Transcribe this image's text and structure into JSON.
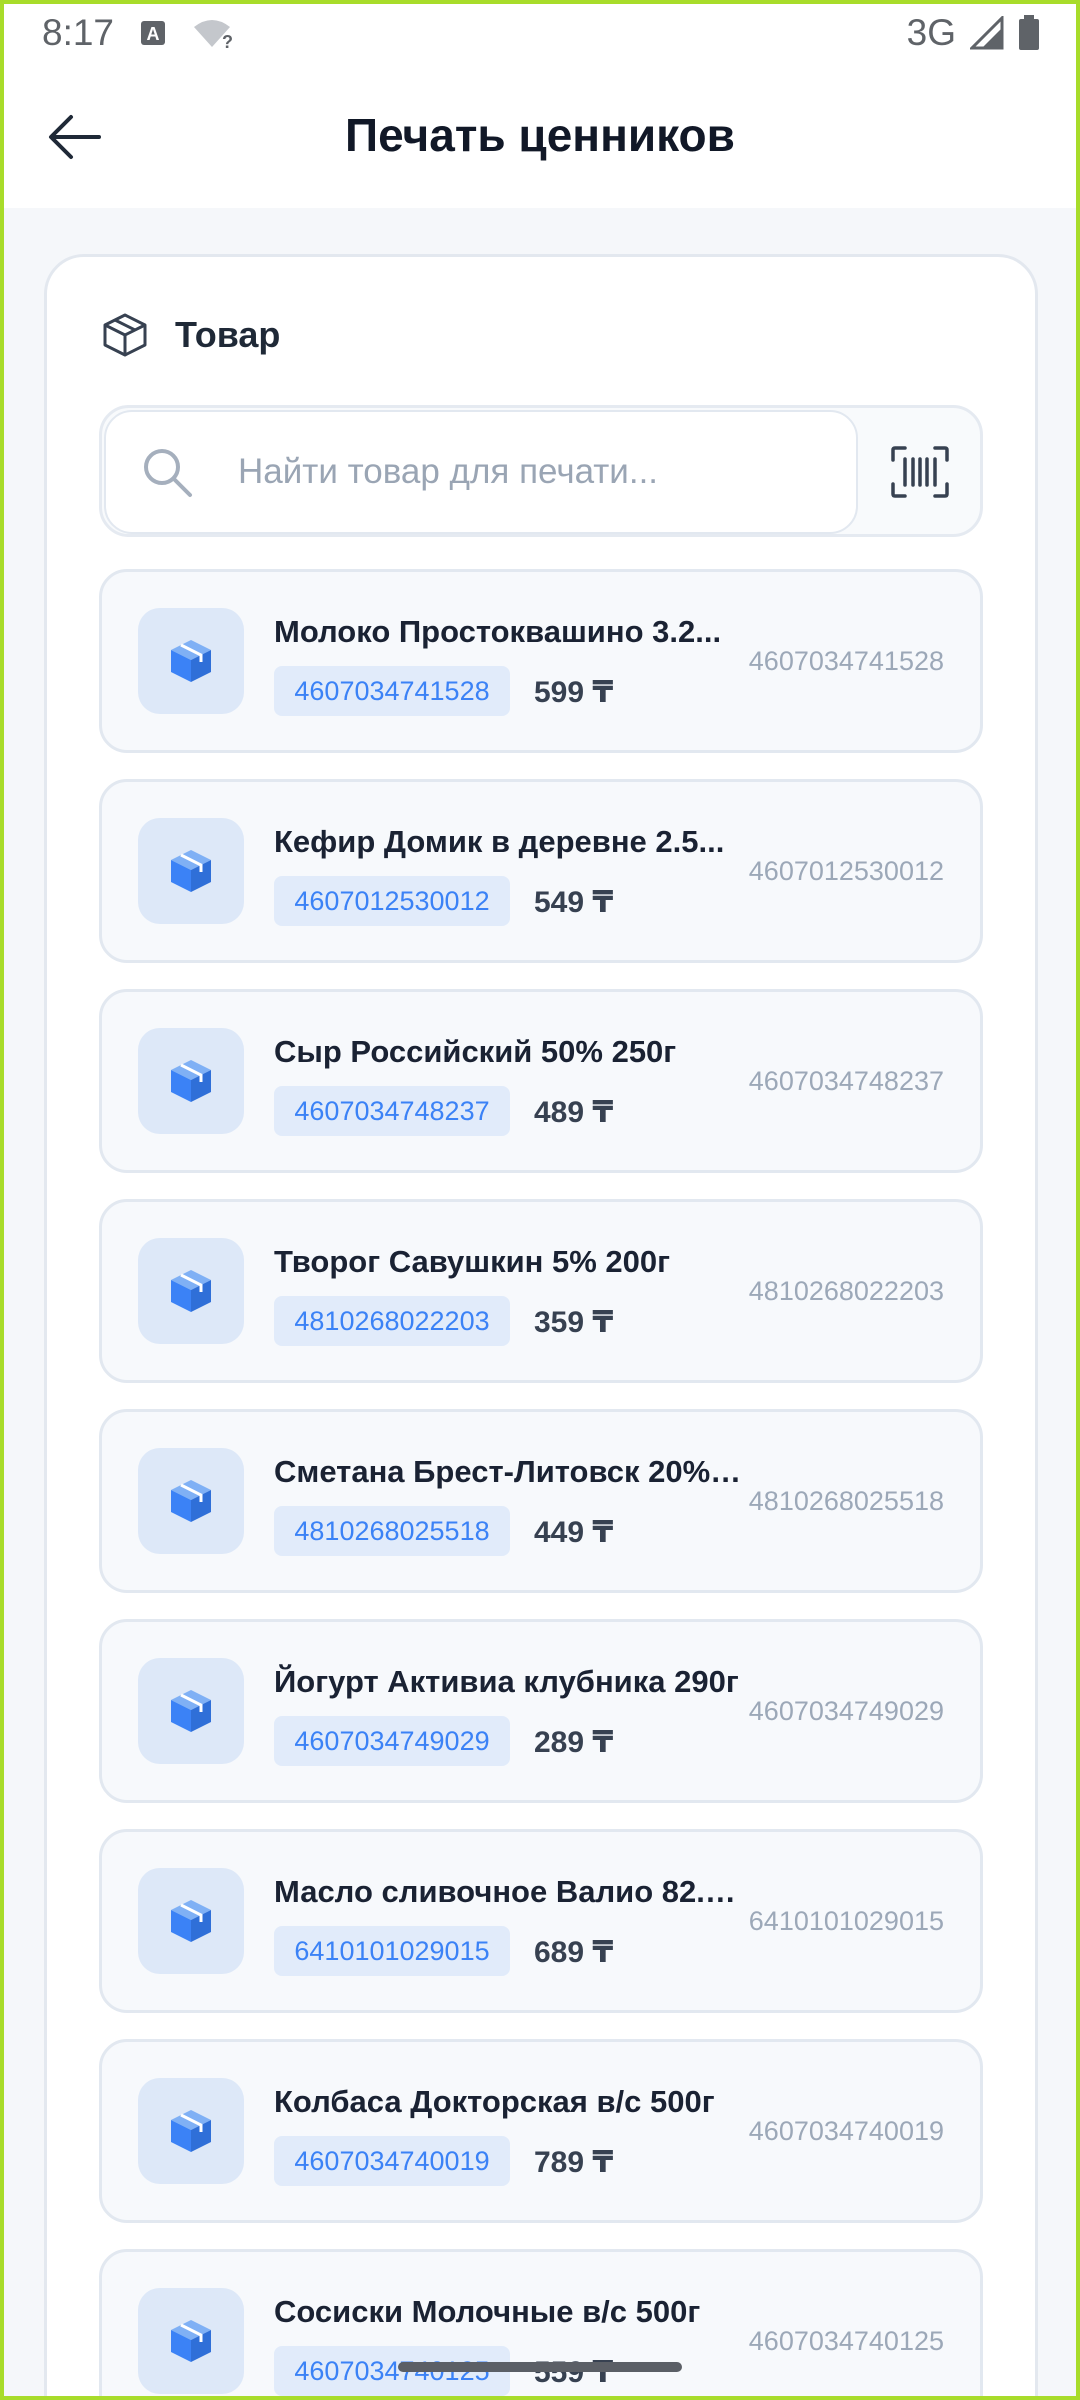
{
  "status_bar": {
    "time": "8:17",
    "network": "3G",
    "icons": [
      "a-notification-icon",
      "wifi-question-icon",
      "cell-signal-icon",
      "battery-icon"
    ]
  },
  "app_bar": {
    "title": "Печать ценников",
    "back_icon": "arrow-left-icon"
  },
  "section": {
    "title": "Товар",
    "icon": "box-icon"
  },
  "search": {
    "placeholder": "Найти товар для печати...",
    "value": "",
    "scan_icon": "barcode-scan-icon"
  },
  "products": [
    {
      "name": "Молоко Простоквашино 3.2...",
      "barcode": "4607034741528",
      "price": "599 ₸",
      "code": "4607034741528"
    },
    {
      "name": "Кефир Домик в деревне 2.5...",
      "barcode": "4607012530012",
      "price": "549 ₸",
      "code": "4607012530012"
    },
    {
      "name": "Сыр Российский 50% 250г",
      "barcode": "4607034748237",
      "price": "489 ₸",
      "code": "4607034748237"
    },
    {
      "name": "Творог Савушкин 5% 200г",
      "barcode": "4810268022203",
      "price": "359 ₸",
      "code": "4810268022203"
    },
    {
      "name": "Сметана Брест-Литовск 20% ...",
      "barcode": "4810268025518",
      "price": "449 ₸",
      "code": "4810268025518"
    },
    {
      "name": "Йогурт Активиа клубника 290г",
      "barcode": "4607034749029",
      "price": "289 ₸",
      "code": "4607034749029"
    },
    {
      "name": "Масло сливочное Валио 82.5...",
      "barcode": "6410101029015",
      "price": "689 ₸",
      "code": "6410101029015"
    },
    {
      "name": "Колбаса Докторская в/с 500г",
      "barcode": "4607034740019",
      "price": "789 ₸",
      "code": "4607034740019"
    },
    {
      "name": "Сосиски Молочные в/с 500г",
      "barcode": "4607034740125",
      "price": "559 ₸",
      "code": "4607034740125"
    }
  ],
  "colors": {
    "accent": "#3b82f6",
    "chip_bg": "#e1ebfa",
    "item_bg": "#f7f9fc",
    "frame": "#a8dc2a"
  }
}
